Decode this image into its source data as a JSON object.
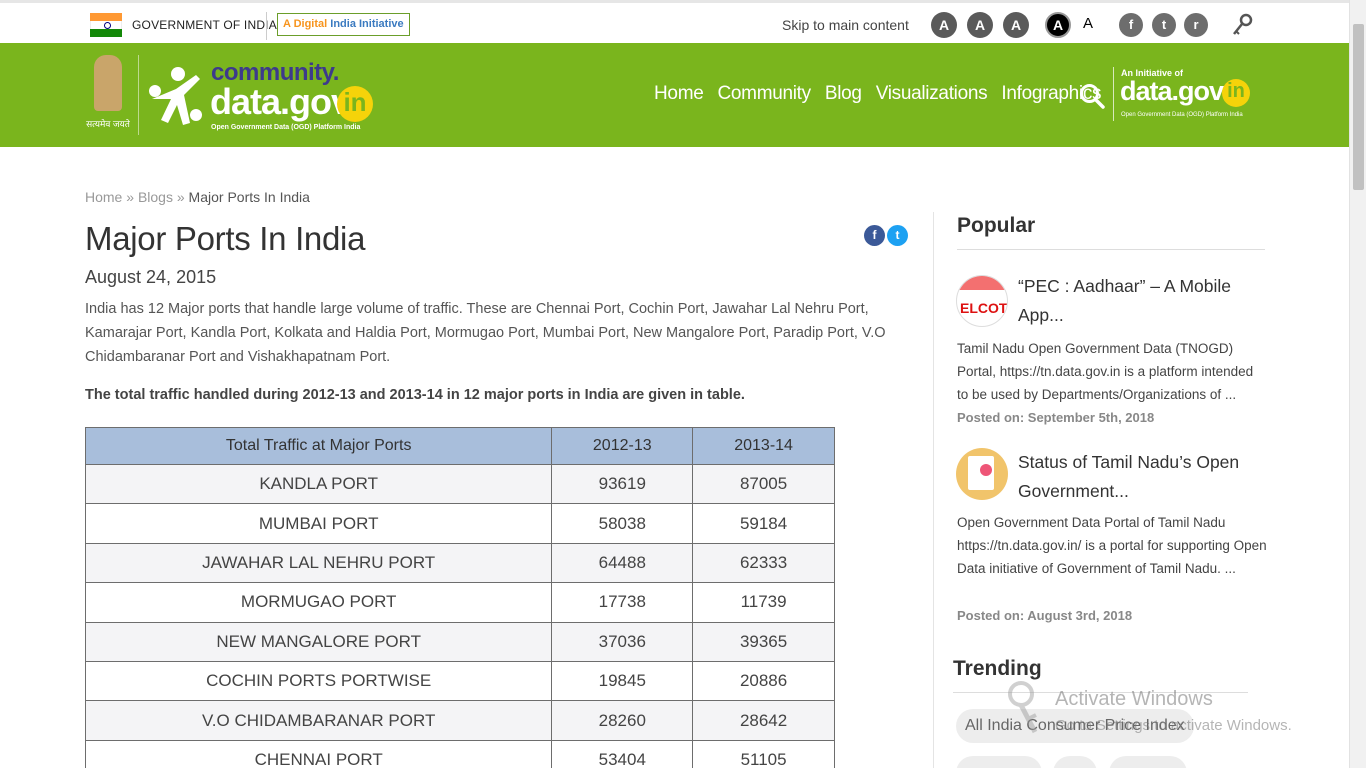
{
  "gov": {
    "label": "GOVERNMENT OF INDIA",
    "digital_prefix": "A Digital ",
    "digital_suffix": "India Initiative"
  },
  "access": {
    "skip_label": "Skip to main content",
    "font_decrease": "A",
    "font_normal": "A",
    "font_increase": "A",
    "high_contrast": "A",
    "normal_contrast": "A"
  },
  "social_top": {
    "facebook": "f",
    "twitter": "t",
    "rss": "r"
  },
  "header": {
    "emblem_text": "सत्यमेव जयते",
    "logo_top": "community.",
    "logo_main": "data.gov",
    "logo_in": "in",
    "logo_tagline": "Open Government Data (OGD) Platform India",
    "nav": [
      "Home",
      "Community",
      "Blog",
      "Visualizations",
      "Infographics"
    ],
    "initiative_small": "An Initiative of",
    "initiative_main": "data.gov",
    "initiative_in": "in",
    "initiative_tagline": "Open Government Data (OGD) Platform India"
  },
  "breadcrumb": {
    "home": "Home",
    "sep1": " » ",
    "blogs": "Blogs",
    "sep2": " » ",
    "current": "Major Ports In India"
  },
  "article": {
    "title": "Major Ports In India",
    "date": "August 24, 2015",
    "intro": "India has 12 Major ports that handle large volume of traffic. These are Chennai Port, Cochin Port, Jawahar Lal Nehru Port, Kamarajar Port, Kandla Port, Kolkata and Haldia Port, Mormugao Port, Mumbai Port, New Mangalore Port, Paradip Port, V.O Chidambaranar Port and Vishakhapatnam Port.",
    "lead": "The total traffic handled during 2012-13 and 2013-14 in 12 major ports in India are given in table.",
    "share_fb": "f",
    "share_tw": "t"
  },
  "table": {
    "headers": [
      "Total Traffic at Major Ports",
      "2012-13",
      "2013-14"
    ],
    "rows": [
      [
        "KANDLA PORT",
        "93619",
        "87005"
      ],
      [
        "MUMBAI PORT",
        "58038",
        "59184"
      ],
      [
        "JAWAHAR LAL NEHRU PORT",
        "64488",
        "62333"
      ],
      [
        "MORMUGAO PORT",
        "17738",
        "11739"
      ],
      [
        "NEW MANGALORE PORT",
        "37036",
        "39365"
      ],
      [
        "COCHIN PORTS PORTWISE",
        "19845",
        "20886"
      ],
      [
        "V.O CHIDAMBARANAR PORT",
        "28260",
        "28642"
      ],
      [
        "CHENNAI PORT",
        "53404",
        "51105"
      ]
    ]
  },
  "sidebar": {
    "popular_heading": "Popular",
    "posts": [
      {
        "thumb_text": "ELCOT",
        "title": "“PEC : Aadhaar” – A Mobile App...",
        "desc": "Tamil Nadu Open Government Data (TNOGD) Portal, https://tn.data.gov.in is a platform intended to be used by Departments/Organizations of ...",
        "date": "Posted on: September 5th, 2018"
      },
      {
        "title": "Status of Tamil Nadu’s Open Government...",
        "desc": "Open Government Data Portal of Tamil Nadu https://tn.data.gov.in/ is a portal for supporting Open Data initiative of Government of Tamil Nadu. ...",
        "date": "Posted on: August 3rd, 2018"
      }
    ],
    "trending_heading": "Trending",
    "trending_tags": [
      "All India Consumer Price Index"
    ]
  },
  "watermark": {
    "title": "Activate Windows",
    "subtitle": "Go to Settings to activate Windows."
  },
  "colors": {
    "brand_green": "#7ab51d",
    "table_header": "#a8bedb",
    "logo_purple": "#3d3a8c",
    "logo_yellow": "#f5d30a"
  }
}
